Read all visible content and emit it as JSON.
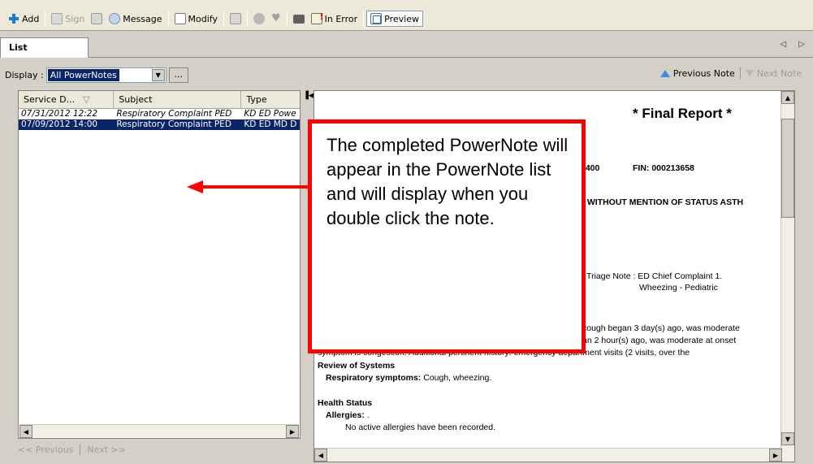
{
  "toolbar": {
    "add": "Add",
    "sign": "Sign",
    "message": "Message",
    "modify": "Modify",
    "in_error": "In Error",
    "preview": "Preview"
  },
  "tabs": {
    "list": "List",
    "arrows": "◁ ▷"
  },
  "display": {
    "label": "Display :",
    "selected": "All PowerNotes",
    "ellipsis": "..."
  },
  "nav": {
    "previous_note": "Previous Note",
    "next_note": "Next Note"
  },
  "list": {
    "columns": [
      "Service D...",
      "Subject",
      "Type"
    ],
    "sort_indicator": "▽",
    "rows": [
      {
        "date": "07/31/2012 12:22",
        "subject": "Respiratory Complaint PED",
        "type": "KD ED Powe",
        "selected": false
      },
      {
        "date": "07/09/2012 14:00",
        "subject": "Respiratory Complaint PED",
        "type": "KD ED MD D",
        "selected": true
      }
    ]
  },
  "pager": {
    "previous": "<< Previous",
    "next": "Next >>"
  },
  "document": {
    "title": "* Final Report *",
    "id_fragment": "1400",
    "fin": "FIN: 000213658",
    "diagnosis_fragment": ", WITHOUT MENTION OF STATUS ASTH",
    "triage_1": "j Triage Note : ED Chief Complaint 1.",
    "triage_2": "Wheezing - Pediatric",
    "hpi_1": "cough began 3  day(s) ago, was moderate",
    "hpi_2": "an 2  hour(s) ago, was moderate at onset",
    "hpi_3": "symptom is congestion.  Additional pertinent history: emergency department visits (2 visits, over the",
    "ros_heading": "Review of Systems",
    "ros_label": "Respiratory symptoms:",
    "ros_value": "Cough, wheezing.",
    "health_heading": "Health Status",
    "allergies_label": "Allergies:",
    "allergies_value": ".",
    "allergies_none": "No active allergies have been recorded."
  },
  "callout": {
    "text": "The completed PowerNote will appear in the PowerNote list and will display when you double click the note."
  },
  "colors": {
    "callout_border": "#ff0000",
    "selection": "#0a246a",
    "nav_arrow": "#3c8fe0"
  }
}
